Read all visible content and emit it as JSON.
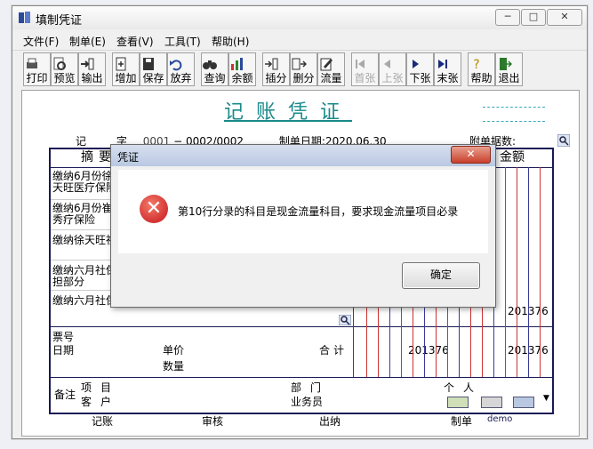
{
  "window": {
    "title": "填制凭证"
  },
  "title_controls": {
    "minimize": "─",
    "maximize": "□",
    "close": "✕"
  },
  "menu": [
    "文件(F)",
    "制单(E)",
    "查看(V)",
    "工具(T)",
    "帮助(H)"
  ],
  "toolbar": [
    "打印",
    "预览",
    "输出",
    "增加",
    "保存",
    "放弃",
    "查询",
    "余额",
    "插分",
    "删分",
    "流量",
    "首张",
    "上张",
    "下张",
    "末张",
    "帮助",
    "退出"
  ],
  "voucher": {
    "title": "记账凭证",
    "word_label": "记",
    "word_suffix": "字",
    "number_a": "0001",
    "number_b": "0002/0002",
    "date_label": "制单日期:",
    "date": "2020.06.30",
    "attach_label": "附单据数:",
    "col_summary": "摘要",
    "col_amount": "金额",
    "rows": [
      "缴纳6月份徐天旺医疗保险",
      "缴纳6月份崔秀疗保险",
      "缴纳徐天旺社",
      "缴纳六月社保担部分",
      "缴纳六月社保"
    ],
    "amount_right": "201376",
    "total_label": "合计",
    "total_amount": "201376",
    "total_amount_right": "201376",
    "ticket_label": "票号",
    "date_field": "日期",
    "price_label": "单价",
    "qty_label": "数量",
    "remark_label": "备注",
    "project_label": "项目",
    "customer_label": "客户",
    "dept_label": "部门",
    "person_label": "个人",
    "clerk_label": "业务员",
    "bookkeep_label": "记账",
    "audit_label": "审核",
    "cashier_label": "出纳",
    "maker_label": "制单",
    "maker_name": "demo"
  },
  "dialog": {
    "title": "凭证",
    "close": "✕",
    "message": "第10行分录的科目是现金流量科目，要求现金流量项目必录",
    "ok": "确定"
  }
}
